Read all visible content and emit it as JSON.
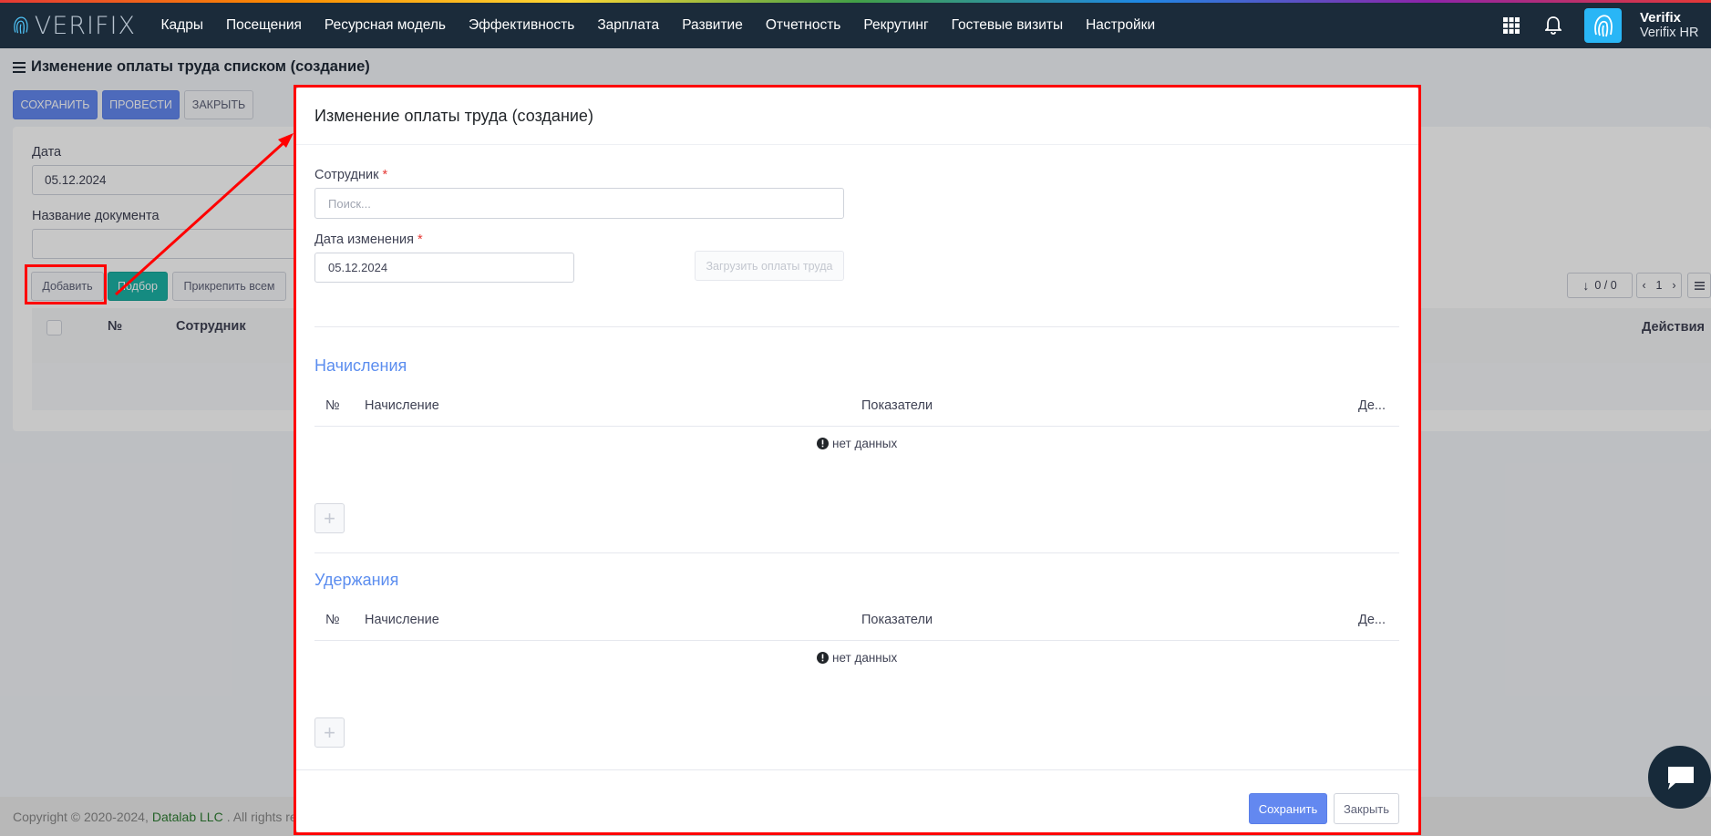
{
  "app": {
    "logo_text": "VERIFIX",
    "nav": [
      "Кадры",
      "Посещения",
      "Ресурсная модель",
      "Эффективность",
      "Зарплата",
      "Развитие",
      "Отчетность",
      "Рекрутинг",
      "Гостевые визиты",
      "Настройки"
    ],
    "user": {
      "name": "Verifix",
      "org": "Verifix HR"
    }
  },
  "page": {
    "title": "Изменение оплаты труда списком (создание)",
    "buttons": {
      "save": "СОХРАНИТЬ",
      "post": "ПРОВЕСТИ",
      "close": "ЗАКРЫТЬ"
    },
    "date_label": "Дата",
    "date_value": "05.12.2024",
    "doc_name_label": "Название документа",
    "doc_name_value": "",
    "list_buttons": {
      "add": "Добавить",
      "pick": "Подбор",
      "attach_all": "Прикрепить всем"
    },
    "pager": {
      "count": "0 / 0",
      "page": "1"
    },
    "table_headers": {
      "num": "№",
      "employee": "Сотрудник",
      "actions": "Действия"
    }
  },
  "footer": {
    "copyright": "Copyright © 2020-2024,",
    "company": "Datalab LLC",
    "rights": ". All rights re"
  },
  "modal": {
    "title": "Изменение оплаты труда (создание)",
    "employee_label": "Сотрудник",
    "employee_placeholder": "Поиск...",
    "change_date_label": "Дата изменения",
    "change_date_value": "05.12.2024",
    "load_button": "Загрузить оплаты труда",
    "accruals": {
      "title": "Начисления",
      "headers": {
        "num": "№",
        "accrual": "Начисление",
        "indicators": "Показатели",
        "actions": "Де..."
      },
      "empty": "нет данных"
    },
    "deductions": {
      "title": "Удержания",
      "headers": {
        "num": "№",
        "accrual": "Начисление",
        "indicators": "Показатели",
        "actions": "Де..."
      },
      "empty": "нет данных"
    },
    "footer_buttons": {
      "save": "Сохранить",
      "close": "Закрыть"
    }
  },
  "colors": {
    "navbar": "#1b2b3a",
    "primary": "#6388f0",
    "teal": "#1bb3a6",
    "section": "#5b8def",
    "annotation": "#ff0000"
  }
}
